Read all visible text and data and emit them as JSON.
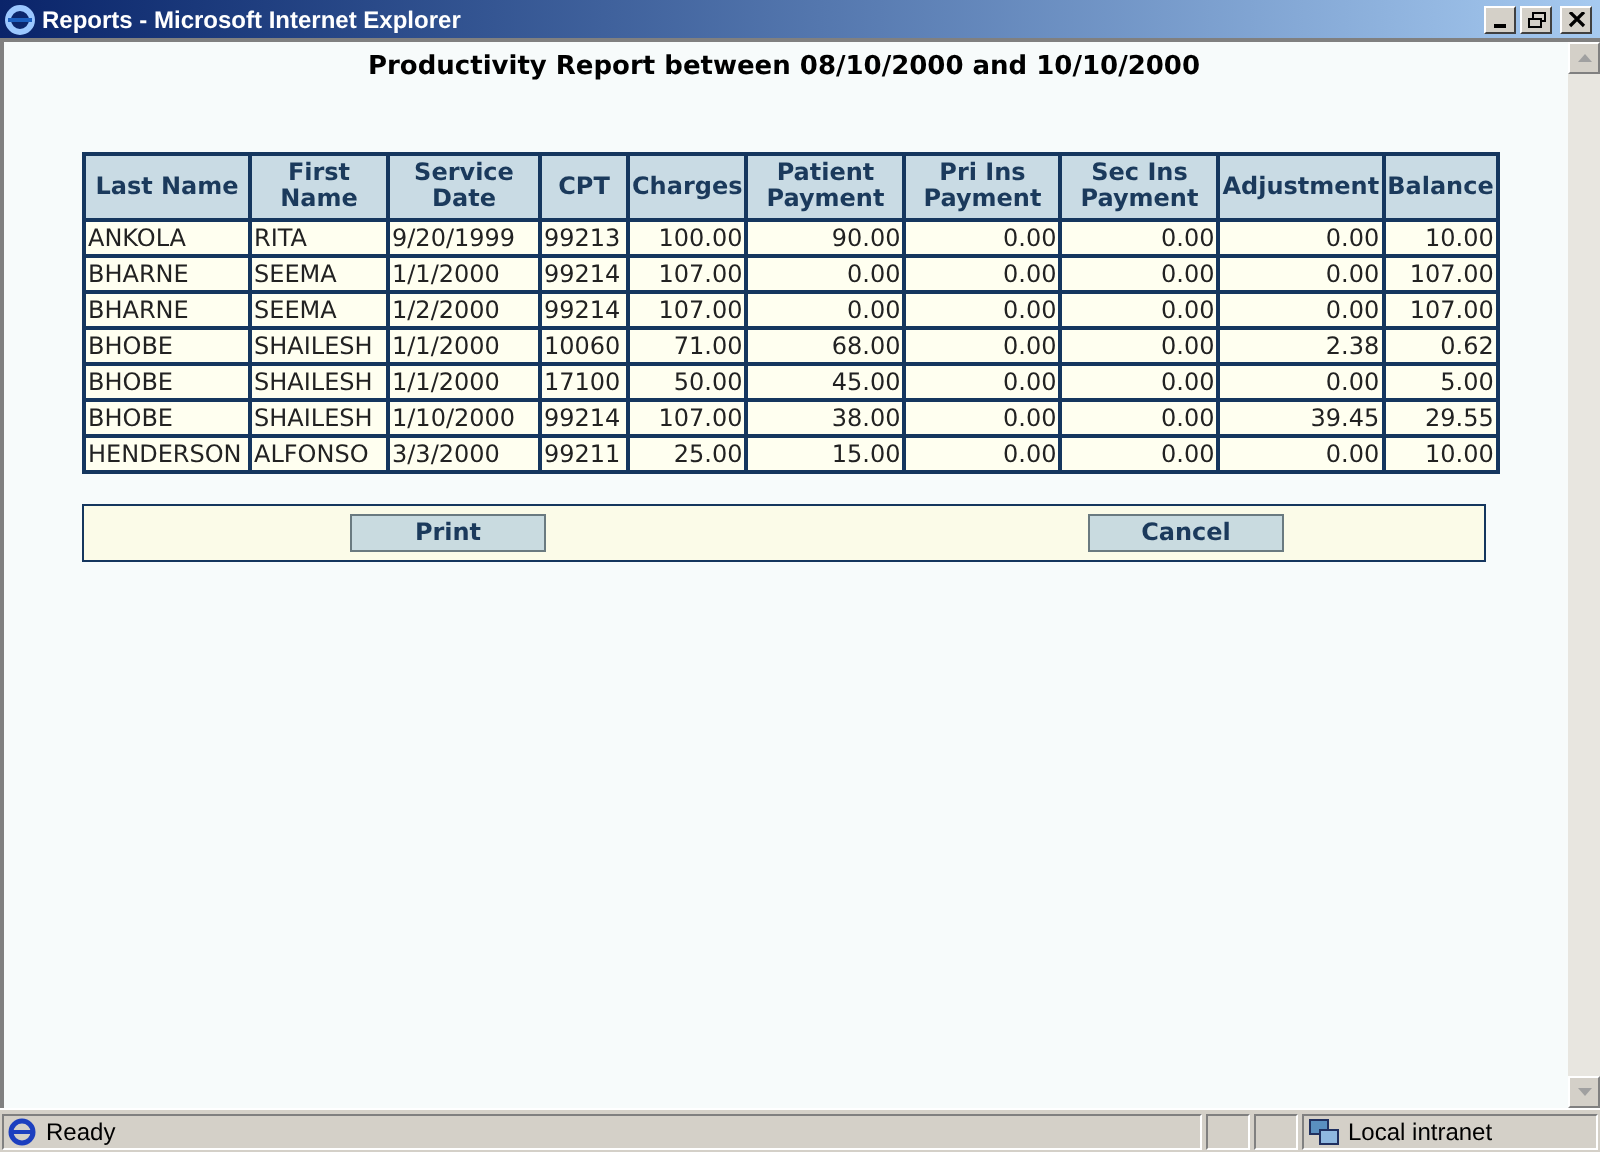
{
  "window": {
    "title": "Reports - Microsoft Internet Explorer"
  },
  "report": {
    "title": "Productivity Report between 08/10/2000 and 10/10/2000"
  },
  "table": {
    "columns": [
      "Last Name",
      "First Name",
      "Service Date",
      "CPT",
      "Charges",
      "Patient Payment",
      "Pri Ins Payment",
      "Sec Ins Payment",
      "Adjustment",
      "Balance"
    ],
    "rows": [
      [
        "ANKOLA",
        "RITA",
        "9/20/1999",
        "99213",
        "100.00",
        "90.00",
        "0.00",
        "0.00",
        "0.00",
        "10.00"
      ],
      [
        "BHARNE",
        "SEEMA",
        "1/1/2000",
        "99214",
        "107.00",
        "0.00",
        "0.00",
        "0.00",
        "0.00",
        "107.00"
      ],
      [
        "BHARNE",
        "SEEMA",
        "1/2/2000",
        "99214",
        "107.00",
        "0.00",
        "0.00",
        "0.00",
        "0.00",
        "107.00"
      ],
      [
        "BHOBE",
        "SHAILESH",
        "1/1/2000",
        "10060",
        "71.00",
        "68.00",
        "0.00",
        "0.00",
        "2.38",
        "0.62"
      ],
      [
        "BHOBE",
        "SHAILESH",
        "1/1/2000",
        "17100",
        "50.00",
        "45.00",
        "0.00",
        "0.00",
        "0.00",
        "5.00"
      ],
      [
        "BHOBE",
        "SHAILESH",
        "1/10/2000",
        "99214",
        "107.00",
        "38.00",
        "0.00",
        "0.00",
        "39.45",
        "29.55"
      ],
      [
        "HENDERSON",
        "ALFONSO",
        "3/3/2000",
        "99211",
        "25.00",
        "15.00",
        "0.00",
        "0.00",
        "0.00",
        "10.00"
      ]
    ]
  },
  "buttons": [
    "Print",
    "Cancel"
  ],
  "status_bar": {
    "status": "Ready",
    "zone": "Local intranet"
  }
}
